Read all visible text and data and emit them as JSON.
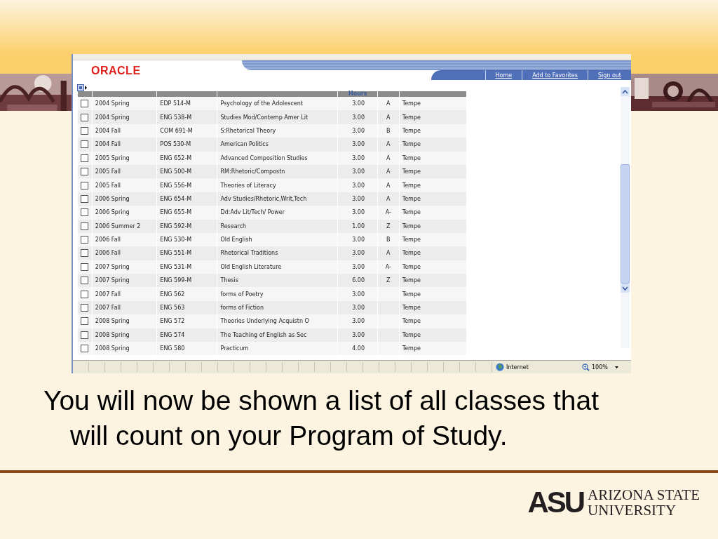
{
  "browser": {
    "logo": "ORACLE",
    "links": [
      "Home",
      "Add to Favorites",
      "Sign out"
    ],
    "table": {
      "header": "Hours",
      "rows": [
        {
          "term": "2004 Spring",
          "course": "EDP 514-M",
          "title": "Psychology of the Adolescent",
          "hours": "3.00",
          "grade": "A",
          "campus": "Tempe",
          "checked": false
        },
        {
          "term": "2004 Spring",
          "course": "ENG 538-M",
          "title": "Studies Mod/Contemp Amer Lit",
          "hours": "3.00",
          "grade": "A",
          "campus": "Tempe",
          "checked": false
        },
        {
          "term": "2004 Fall",
          "course": "COM 691-M",
          "title": "S:Rhetorical Theory",
          "hours": "3.00",
          "grade": "B",
          "campus": "Tempe",
          "checked": false
        },
        {
          "term": "2004 Fall",
          "course": "POS 530-M",
          "title": "American Politics",
          "hours": "3.00",
          "grade": "A",
          "campus": "Tempe",
          "checked": false
        },
        {
          "term": "2005 Spring",
          "course": "ENG 652-M",
          "title": "Advanced Composition Studies",
          "hours": "3.00",
          "grade": "A",
          "campus": "Tempe",
          "checked": false
        },
        {
          "term": "2005 Fall",
          "course": "ENG 500-M",
          "title": "RM:Rhetoric/Compostn",
          "hours": "3.00",
          "grade": "A",
          "campus": "Tempe",
          "checked": false
        },
        {
          "term": "2005 Fall",
          "course": "ENG 556-M",
          "title": "Theories of Literacy",
          "hours": "3.00",
          "grade": "A",
          "campus": "Tempe",
          "checked": false
        },
        {
          "term": "2006 Spring",
          "course": "ENG 654-M",
          "title": "Adv Studies/Rhetoric,Writ,Tech",
          "hours": "3.00",
          "grade": "A",
          "campus": "Tempe",
          "checked": false
        },
        {
          "term": "2006 Spring",
          "course": "ENG 655-M",
          "title": "Dd:Adv Lit/Tech/ Power",
          "hours": "3.00",
          "grade": "A-",
          "campus": "Tempe",
          "checked": false
        },
        {
          "term": "2006 Summer 2",
          "course": "ENG 592-M",
          "title": "Research",
          "hours": "1.00",
          "grade": "Z",
          "campus": "Tempe",
          "checked": false
        },
        {
          "term": "2006 Fall",
          "course": "ENG 530-M",
          "title": "Old English",
          "hours": "3.00",
          "grade": "B",
          "campus": "Tempe",
          "checked": false
        },
        {
          "term": "2006 Fall",
          "course": "ENG 551-M",
          "title": "Rhetorical Traditions",
          "hours": "3.00",
          "grade": "A",
          "campus": "Tempe",
          "checked": false
        },
        {
          "term": "2007 Spring",
          "course": "ENG 531-M",
          "title": "Old English Literature",
          "hours": "3.00",
          "grade": "A-",
          "campus": "Tempe",
          "checked": false
        },
        {
          "term": "2007 Spring",
          "course": "ENG 599-M",
          "title": "Thesis",
          "hours": "6.00",
          "grade": "Z",
          "campus": "Tempe",
          "checked": false
        },
        {
          "term": "2007 Fall",
          "course": "ENG 562",
          "title": "forms of Poetry",
          "hours": "3.00",
          "campus": "Tempe",
          "checked": false
        },
        {
          "term": "2007 Fall",
          "course": "ENG 563",
          "title": "forms of Fiction",
          "hours": "3.00",
          "campus": "Tempe",
          "checked": false
        },
        {
          "term": "2008 Spring",
          "course": "ENG 572",
          "title": "Theories Underlying Acquistn O",
          "hours": "3.00",
          "campus": "Tempe",
          "checked": false
        },
        {
          "term": "2008 Spring",
          "course": "ENG 574",
          "title": "The Teaching of English as Sec",
          "hours": "3.00",
          "campus": "Tempe",
          "checked": false
        },
        {
          "term": "2008 Spring",
          "course": "ENG 580",
          "title": "Practicum",
          "hours": "4.00",
          "campus": "Tempe",
          "checked": false
        }
      ]
    },
    "status_bar": {
      "zone": "Internet",
      "zoom": "100%"
    }
  },
  "caption": "You will now be shown a list of all classes that will count on your Program of Study.",
  "footer": {
    "logo": "ASU",
    "name_lines": [
      "ARIZONA STATE",
      "UNIVERSITY"
    ]
  }
}
